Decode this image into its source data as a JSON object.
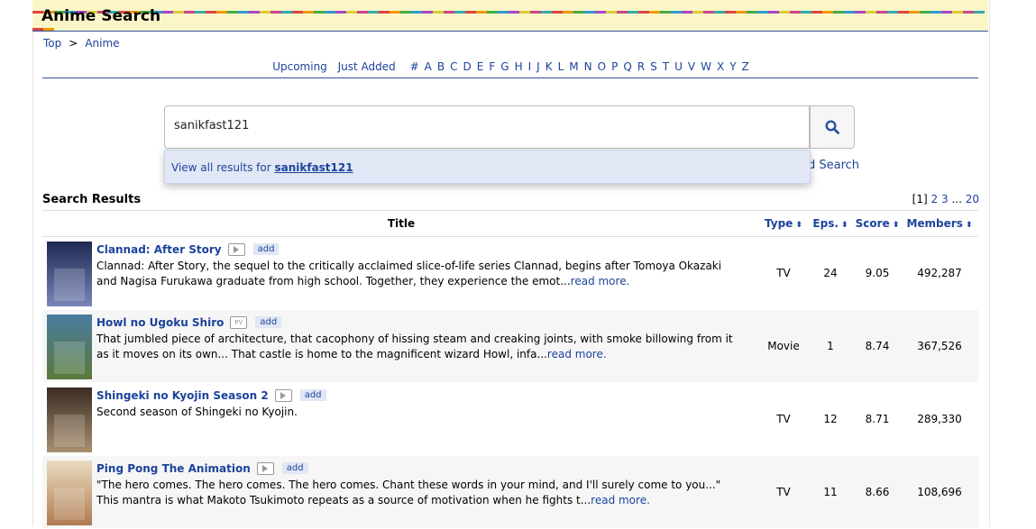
{
  "header": {
    "title": "Anime Search"
  },
  "breadcrumb": {
    "top": "Top",
    "sep": ">",
    "current": "Anime"
  },
  "letters": {
    "upcoming": "Upcoming",
    "just_added": "Just Added",
    "items": [
      "#",
      "A",
      "B",
      "C",
      "D",
      "E",
      "F",
      "G",
      "H",
      "I",
      "J",
      "K",
      "L",
      "M",
      "N",
      "O",
      "P",
      "Q",
      "R",
      "S",
      "T",
      "U",
      "V",
      "W",
      "X",
      "Y",
      "Z"
    ]
  },
  "search": {
    "value": "sanikfast121",
    "suggest_prefix": "View all results for ",
    "suggest_query": "sanikfast121",
    "advanced_fragment": "d Search"
  },
  "results": {
    "title": "Search Results",
    "pager": {
      "current": "[1]",
      "p2": "2",
      "p3": "3",
      "ellipsis": "...",
      "last": "20"
    },
    "headers": {
      "title": "Title",
      "type": "Type",
      "eps": "Eps.",
      "score": "Score",
      "members": "Members"
    },
    "rows": [
      {
        "name": "Clannad: After Story",
        "trailer": "play",
        "add": "add",
        "synopsis": "Clannad: After Story, the sequel to the critically acclaimed slice-of-life series Clannad, begins after Tomoya Okazaki and Nagisa Furukawa graduate from high school. Together, they experience the emot...",
        "read_more": "read more.",
        "type": "TV",
        "eps": "24",
        "score": "9.05",
        "members": "492,287",
        "colors": [
          "#1d2a52",
          "#7a86b8"
        ]
      },
      {
        "name": "Howl no Ugoku Shiro",
        "trailer": "PV",
        "add": "add",
        "synopsis": "That jumbled piece of architecture, that cacophony of hissing steam and creaking joints, with smoke billowing from it as it moves on its own... That castle is home to the magnificent wizard Howl, infa...",
        "read_more": "read more.",
        "type": "Movie",
        "eps": "1",
        "score": "8.74",
        "members": "367,526",
        "colors": [
          "#4a7ba0",
          "#5a7a3a"
        ]
      },
      {
        "name": "Shingeki no Kyojin Season 2",
        "trailer": "play",
        "add": "add",
        "synopsis": "Second season of Shingeki no Kyojin.",
        "read_more": "",
        "type": "TV",
        "eps": "12",
        "score": "8.71",
        "members": "289,330",
        "colors": [
          "#3b2b22",
          "#a89070"
        ]
      },
      {
        "name": "Ping Pong The Animation",
        "trailer": "play",
        "add": "add",
        "synopsis": "\"The hero comes. The hero comes. The hero comes. Chant these words in your mind, and I'll surely come to you...\" This mantra is what Makoto Tsukimoto repeats as a source of motivation when he fights t...",
        "read_more": "read more.",
        "type": "TV",
        "eps": "11",
        "score": "8.66",
        "members": "108,696",
        "colors": [
          "#e9dcc0",
          "#b07a50"
        ]
      }
    ]
  }
}
